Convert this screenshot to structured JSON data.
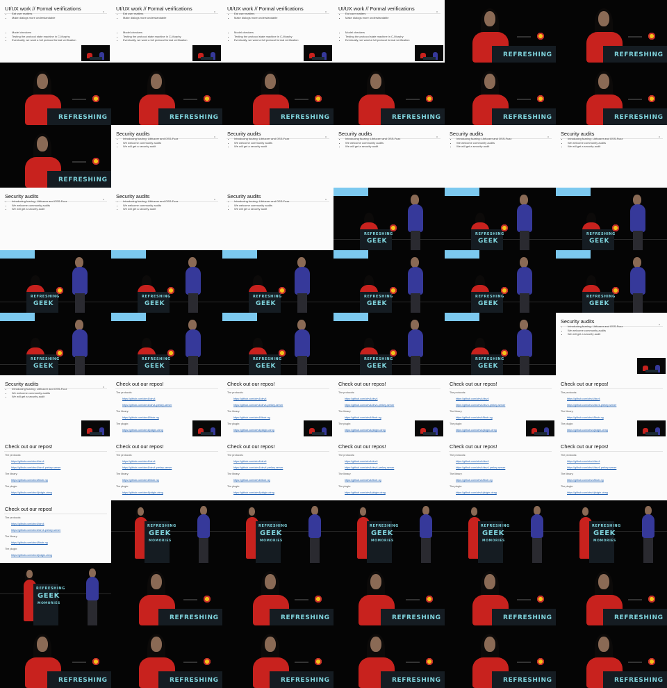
{
  "slides": {
    "ui": {
      "title": "UI/UX work // Formal verifications",
      "bullets_a": [
        "Eat user matters",
        "Make dialogs more understandable"
      ],
      "bullets_b": [
        "Model checkers",
        "Testing the protocol state machine in C-Murphy",
        "Eventually, we want a full protocol formal verification"
      ]
    },
    "audit": {
      "title": "Security audits",
      "bullets": [
        "Introducing fuzzing: Libfuzzer and OSS-Fuzz",
        "We welcome community audits",
        "We will get a security audit"
      ]
    },
    "repos": {
      "title": "Check out our repos!",
      "groups": [
        {
          "label": "The protocols:",
          "urls": [
            "https://github.com/otrv4/otrv4",
            "https://github.com/otrv4/otrv4-prekey-server"
          ]
        },
        {
          "label": "The library:",
          "urls": [
            "https://github.com/otrv4/libotr-ng"
          ]
        },
        {
          "label": "The plugin:",
          "urls": [
            "https://github.com/otrv4/pidgin-otrng"
          ]
        }
      ]
    }
  },
  "branding": {
    "wide": "REFRESHING",
    "stacked_line1": "REFRESHING",
    "stacked_line2": "GEEK",
    "stacked_line3": "MOMORIES"
  },
  "layout_grid": {
    "columns": 6,
    "rows": 11,
    "frames": [
      "ui",
      "ui",
      "ui",
      "ui",
      "close-red",
      "close-red",
      "close-red",
      "close-red",
      "close-red",
      "close-red",
      "close-red",
      "close-red",
      "close-red",
      "audit",
      "audit",
      "audit",
      "audit",
      "audit",
      "audit",
      "audit",
      "audit",
      "duo",
      "duo",
      "duo",
      "duo",
      "duo",
      "duo",
      "duo",
      "duo",
      "duo",
      "duo",
      "duo",
      "duo",
      "duo",
      "duo",
      "audit-pip",
      "audit-pip",
      "repos-pip",
      "repos-pip",
      "repos-pip",
      "repos-pip",
      "repos-pip",
      "repos",
      "repos",
      "repos",
      "repos",
      "repos",
      "repos",
      "repos",
      "wide",
      "wide",
      "wide",
      "wide",
      "wide",
      "wide",
      "close-red",
      "close-red",
      "close-red",
      "close-red",
      "close-red",
      "close-red",
      "close-red",
      "close-red",
      "close-red",
      "close-red",
      "close-red"
    ]
  },
  "colors": {
    "slide_bg": "#fbfbfb",
    "stage_bg": "#050505",
    "red_outfit": "#c8221e",
    "blue_outfit": "#36399a",
    "brand_teal": "#7fd3dc",
    "link_blue": "#1d5fb2",
    "screen_blue": "#7cc9ef"
  }
}
